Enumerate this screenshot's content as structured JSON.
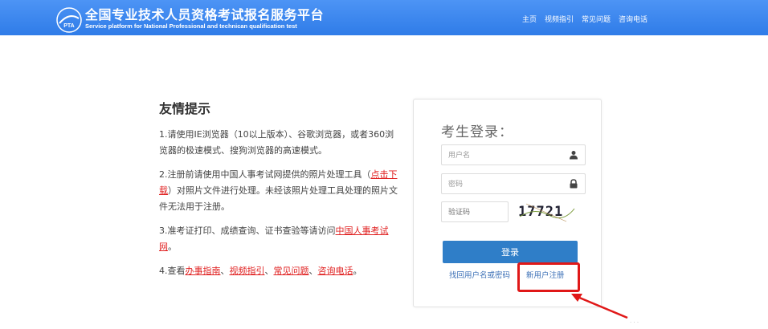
{
  "header": {
    "title": "全国专业技术人员资格考试报名服务平台",
    "subtitle": "Service platform for National Professional and technican qualification test",
    "logo_text": "PTA",
    "nav": [
      {
        "label": "主页"
      },
      {
        "label": "视频指引"
      },
      {
        "label": "常见问题"
      },
      {
        "label": "咨询电话"
      }
    ]
  },
  "tips": {
    "heading": "友情提示",
    "tip1": "1.请使用IE浏览器（10以上版本）、谷歌浏览器，或者360浏览器的极速模式、搜狗浏览器的高速模式。",
    "tip2_pre": "2.注册前请使用中国人事考试网提供的照片处理工具（",
    "tip2_link": "点击下载",
    "tip2_post": "）对照片文件进行处理。未经该照片处理工具处理的照片文件无法用于注册。",
    "tip3_pre": "3.准考证打印、成绩查询、证书查验等请访问",
    "tip3_link": "中国人事考试网",
    "tip3_post": "。",
    "tip4_pre": "4.查看",
    "tip4_links": [
      "办事指南",
      "视频指引",
      "常见问题",
      "咨询电话"
    ],
    "tip4_sep": "、",
    "tip4_post": "。"
  },
  "login": {
    "title": "考生登录：",
    "username_placeholder": "用户名",
    "password_placeholder": "密码",
    "captcha_placeholder": "验证码",
    "captcha_text": "17721",
    "login_button": "登录",
    "forgot_link": "找回用户名或密码",
    "register_link": "新用户注册"
  },
  "colors": {
    "header_bg": "#2f7ce8",
    "button_bg": "#2f7ec8",
    "link_red": "#e02020",
    "link_blue": "#3b6fb6",
    "highlight_red": "#e01818"
  }
}
